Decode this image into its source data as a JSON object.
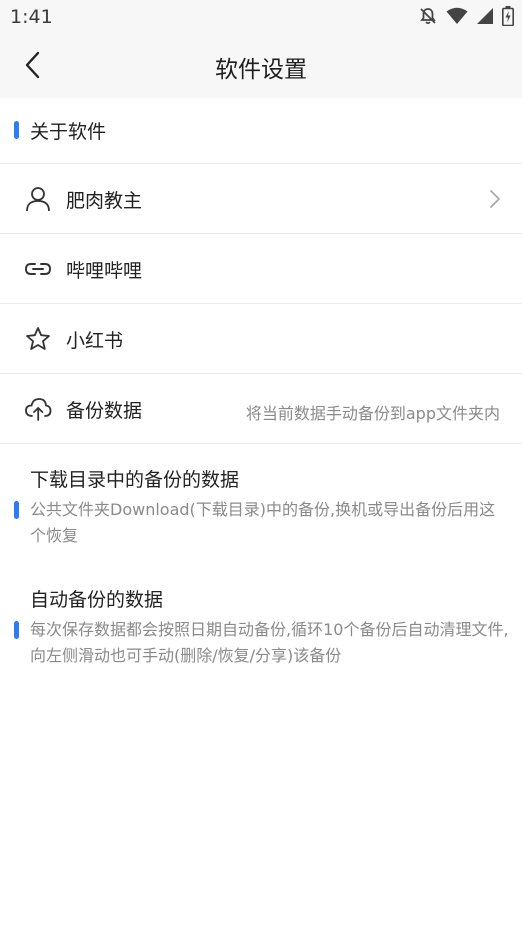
{
  "status_bar": {
    "time": "1:41",
    "icons": [
      "bell-muted-icon",
      "wifi-icon",
      "cellular-signal-icon",
      "battery-charging-icon"
    ]
  },
  "header": {
    "title": "软件设置",
    "back_icon": "chevron-left-icon"
  },
  "section_about": {
    "label": "关于软件"
  },
  "rows": [
    {
      "icon": "user-icon",
      "label": "肥肉教主",
      "has_chevron": true
    },
    {
      "icon": "link-icon",
      "label": "哔哩哔哩"
    },
    {
      "icon": "star-icon",
      "label": "小红书"
    },
    {
      "icon": "cloud-upload-icon",
      "label": "备份数据",
      "note": "将当前数据手动备份到app文件夹内"
    }
  ],
  "info_blocks": [
    {
      "title": "下载目录中的备份的数据",
      "description": "公共文件夹Download(下载目录)中的备份,换机或导出备份后用这个恢复"
    },
    {
      "title": "自动备份的数据",
      "description": "每次保存数据都会按照日期自动备份,循环10个备份后自动清理文件,向左侧滑动也可手动(删除/恢复/分享)该备份"
    }
  ],
  "colors": {
    "accent": "#2f7bf5",
    "header_bg": "#f7f7f7",
    "divider": "#ececec",
    "secondary_text": "#8a8a8a"
  }
}
